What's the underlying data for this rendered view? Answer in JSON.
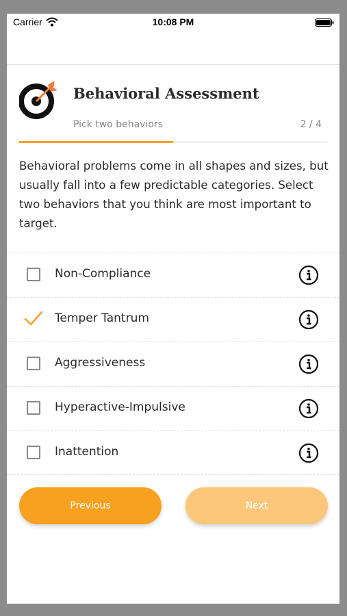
{
  "status_bar": {
    "carrier": "Carrier",
    "time": "10:08 PM"
  },
  "header": {
    "title": "Behavioral Assessment",
    "subtitle": "Pick two behaviors",
    "step": "2 / 4",
    "progress": 0.5
  },
  "description": "Behavioral problems come in all shapes and sizes, but usually fall into a few predictable categories. Select two behaviors that you think are most important to target.",
  "options": [
    {
      "label": "Non-Compliance",
      "selected": false
    },
    {
      "label": "Temper Tantrum",
      "selected": true
    },
    {
      "label": "Aggressiveness",
      "selected": false
    },
    {
      "label": "Hyperactive-Impulsive",
      "selected": false
    },
    {
      "label": "Inattention",
      "selected": false
    }
  ],
  "buttons": {
    "previous": "Previous",
    "next": "Next"
  },
  "colors": {
    "accent": "#f5a12e",
    "button_active": "#f8a01f",
    "button_disabled": "#fcc77a",
    "text": "#2a2a2a",
    "muted": "#858585"
  },
  "icons": {
    "logo": "target-dart-icon",
    "info": "info-circle-icon",
    "check": "checkmark-icon"
  }
}
